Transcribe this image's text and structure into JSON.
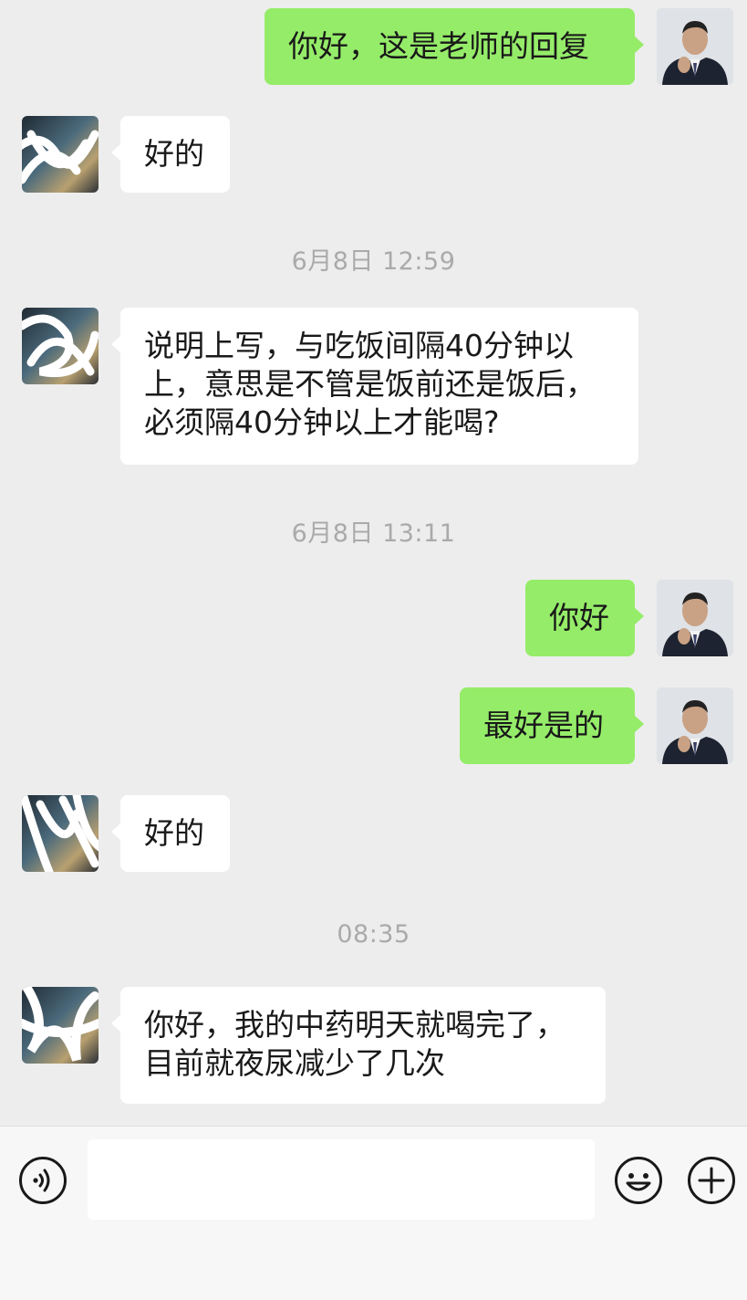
{
  "messages": [
    {
      "side": "me",
      "text": "你好，这是老师的回复"
    },
    {
      "side": "them",
      "text": "好的"
    },
    {
      "side": "them",
      "text": "说明上写，与吃饭间隔40分钟以\n上，意思是不管是饭前还是饭后，\n必须隔40分钟以上才能喝?"
    },
    {
      "side": "me",
      "text": "你好"
    },
    {
      "side": "me",
      "text": "最好是的"
    },
    {
      "side": "them",
      "text": "好的"
    },
    {
      "side": "them",
      "text": "你好，我的中药明天就喝完了，\n目前就夜尿减少了几次"
    }
  ],
  "timestamps": [
    "6月8日 12:59",
    "6月8日 13:11",
    "08:35"
  ],
  "input": {
    "value": "",
    "placeholder": ""
  },
  "icons": {
    "voice": "voice-icon",
    "emoji": "emoji-icon",
    "more": "plus-icon"
  },
  "colors": {
    "background": "#ededed",
    "my_bubble": "#95ec69",
    "their_bubble": "#ffffff",
    "timestamp": "#aaaaaa",
    "input_bar": "#f7f7f7"
  }
}
